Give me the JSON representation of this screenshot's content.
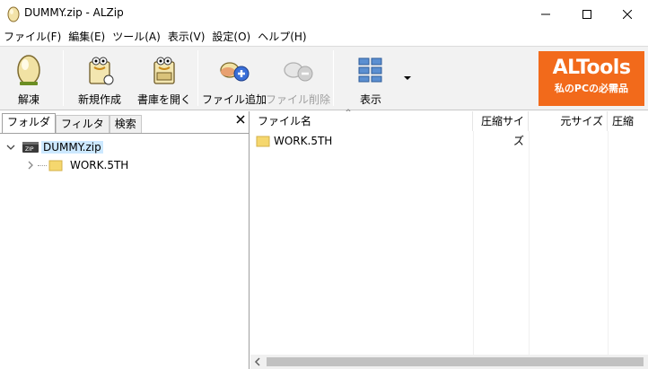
{
  "window": {
    "title": "DUMMY.zip - ALZip"
  },
  "menu": [
    "ファイル(F)",
    "編集(E)",
    "ツール(A)",
    "表示(V)",
    "設定(O)",
    "ヘルプ(H)"
  ],
  "toolbar": {
    "extract": "解凍",
    "new": "新規作成",
    "open": "書庫を開く",
    "add_file": "ファイル追加",
    "delete_file": "ファイル削除",
    "view": "表示"
  },
  "banner": {
    "title": "ALTools",
    "subtitle": "私のPCの必需品"
  },
  "left_pane": {
    "tabs": [
      "フォルダ",
      "フィルタ",
      "検索"
    ],
    "active_tab": "フォルダ",
    "tree": {
      "root": "DUMMY.zip",
      "children": [
        "WORK.5TH"
      ]
    }
  },
  "file_list": {
    "columns": [
      "ファイル名",
      "圧縮サイズ",
      "元サイズ",
      "圧縮"
    ],
    "rows": [
      {
        "name": "WORK.5TH"
      }
    ]
  },
  "colors": {
    "banner": "#f26a1b",
    "selection": "#cce8ff",
    "folder": "#f5d76e",
    "toolbar_bg": "#f2f2f2"
  }
}
